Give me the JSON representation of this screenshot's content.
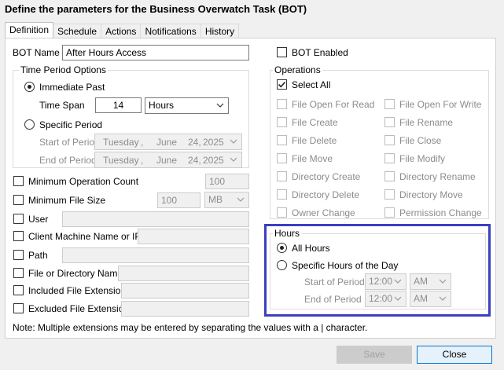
{
  "window": {
    "title": "Define the parameters for the Business Overwatch Task (BOT)"
  },
  "tabs": [
    {
      "label": "Definition",
      "active": true
    },
    {
      "label": "Schedule"
    },
    {
      "label": "Actions"
    },
    {
      "label": "Notifications"
    },
    {
      "label": "History"
    }
  ],
  "definition": {
    "bot_name_label": "BOT Name",
    "bot_name_value": "After Hours Access",
    "bot_enabled_label": "BOT Enabled",
    "time_period": {
      "group_label": "Time Period Options",
      "immediate_past_label": "Immediate Past",
      "time_span_label": "Time Span",
      "time_span_value": "14",
      "time_span_unit": "Hours",
      "specific_period_label": "Specific Period",
      "start_label": "Start of Period",
      "end_label": "End of Period",
      "start_date": {
        "weekday": "Tuesday",
        "sep": ",",
        "month": "June",
        "day": "24,",
        "year": "2025"
      },
      "end_date": {
        "weekday": "Tuesday",
        "sep": ",",
        "month": "June",
        "day": "24,",
        "year": "2025"
      }
    },
    "filters": {
      "min_op_count_label": "Minimum Operation Count",
      "min_op_count_value": "100",
      "min_file_size_label": "Minimum File Size",
      "min_file_size_value": "100",
      "min_file_size_unit": "MB",
      "user_label": "User",
      "client_label": "Client Machine Name or IP",
      "path_label": "Path",
      "file_dir_label": "File or Directory Name",
      "included_ext_label": "Included File Extensions",
      "excluded_ext_label": "Excluded File Extensions"
    },
    "operations": {
      "group_label": "Operations",
      "select_all_label": "Select All",
      "left": [
        "File Open For Read",
        "File Create",
        "File Delete",
        "File Move",
        "Directory Create",
        "Directory Delete",
        "Owner Change"
      ],
      "right": [
        "File Open For Write",
        "File Rename",
        "File Close",
        "File Modify",
        "Directory Rename",
        "Directory Move",
        "Permission Change"
      ]
    },
    "hours": {
      "group_label": "Hours",
      "all_hours_label": "All Hours",
      "specific_label": "Specific Hours of the Day",
      "start_label": "Start of Period",
      "end_label": "End of Period",
      "start_time": "12:00",
      "start_ampm": "AM",
      "end_time": "12:00",
      "end_ampm": "AM"
    },
    "note": "Note: Multiple extensions may be entered by separating the values with a | character."
  },
  "footer": {
    "save_label": "Save",
    "close_label": "Close"
  },
  "colors": {
    "highlight": "#3b3fc0",
    "accent": "#0078d7"
  }
}
